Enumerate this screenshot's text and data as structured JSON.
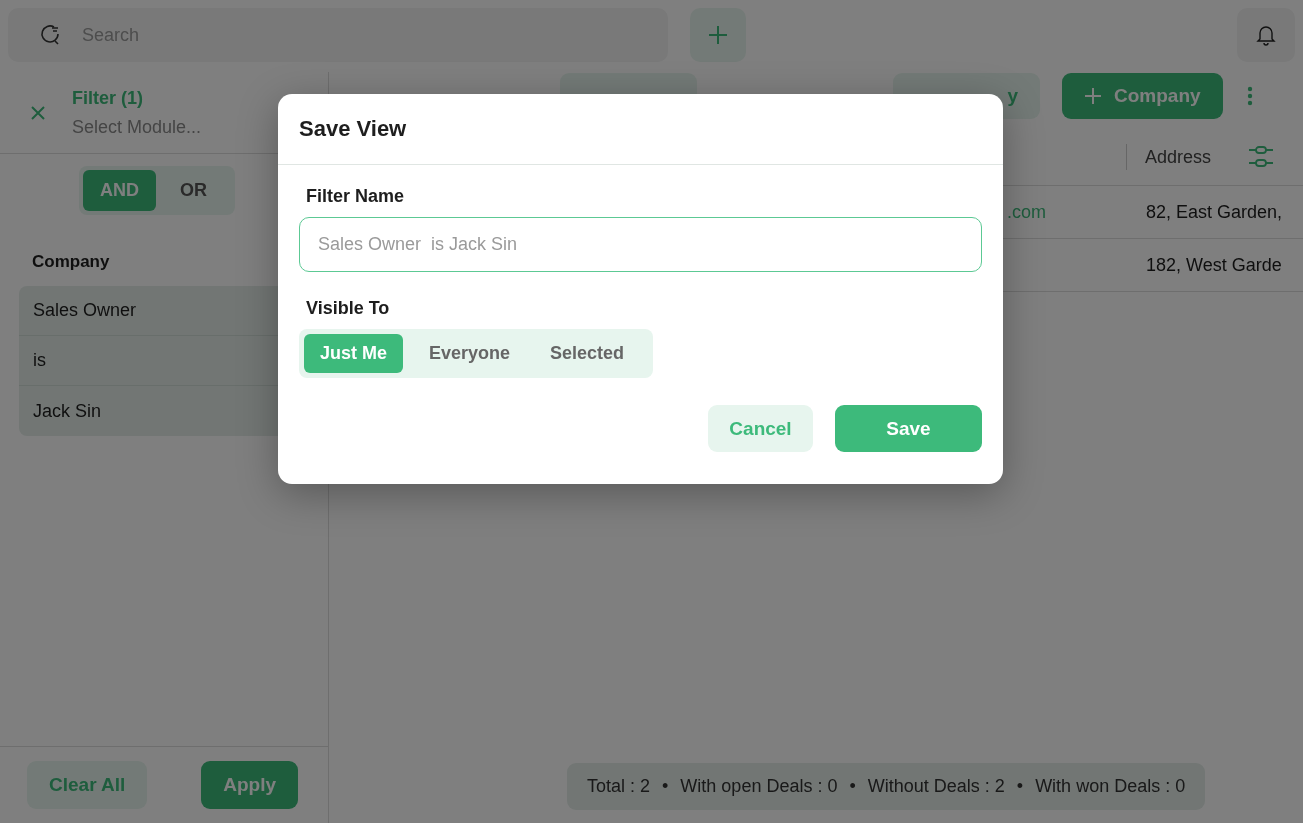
{
  "topbar": {
    "search": {
      "placeholder": "Search"
    }
  },
  "filter_panel": {
    "title": "Filter (1)",
    "module_placeholder": "Select Module...",
    "logic": [
      {
        "label": "AND",
        "selected": true
      },
      {
        "label": "OR",
        "selected": false
      }
    ],
    "group_label": "Company",
    "conditions": [
      "Sales Owner",
      "is",
      "Jack Sin"
    ],
    "buttons": [
      {
        "label": "Clear All",
        "kind": "secondary"
      },
      {
        "label": "Apply",
        "kind": "primary"
      }
    ]
  },
  "toolbar": {
    "buttons": [
      {
        "kind": "secondary"
      },
      {
        "label": "y",
        "kind": "secondary"
      },
      {
        "label": "Company",
        "kind": "primary"
      }
    ]
  },
  "table": {
    "columns": [
      "Address"
    ],
    "rows": [
      {
        "email": ".com",
        "address": "82, East Garden,"
      },
      {
        "address": "182, West Garde"
      }
    ]
  },
  "summary": {
    "items": [
      "Total : 2",
      "With open Deals : 0",
      "Without Deals : 2",
      "With won Deals : 0"
    ],
    "separator": "•"
  },
  "modal": {
    "title": "Save View",
    "field_label": "Filter Name",
    "field_placeholder": "Sales Owner  is Jack Sin",
    "visibility_label": "Visible To",
    "visibility": [
      {
        "label": "Just Me",
        "selected": true
      },
      {
        "label": "Everyone",
        "selected": false
      },
      {
        "label": "Selected",
        "selected": false
      }
    ],
    "buttons": [
      {
        "label": "Cancel",
        "kind": "secondary"
      },
      {
        "label": "Save",
        "kind": "primary"
      }
    ]
  }
}
